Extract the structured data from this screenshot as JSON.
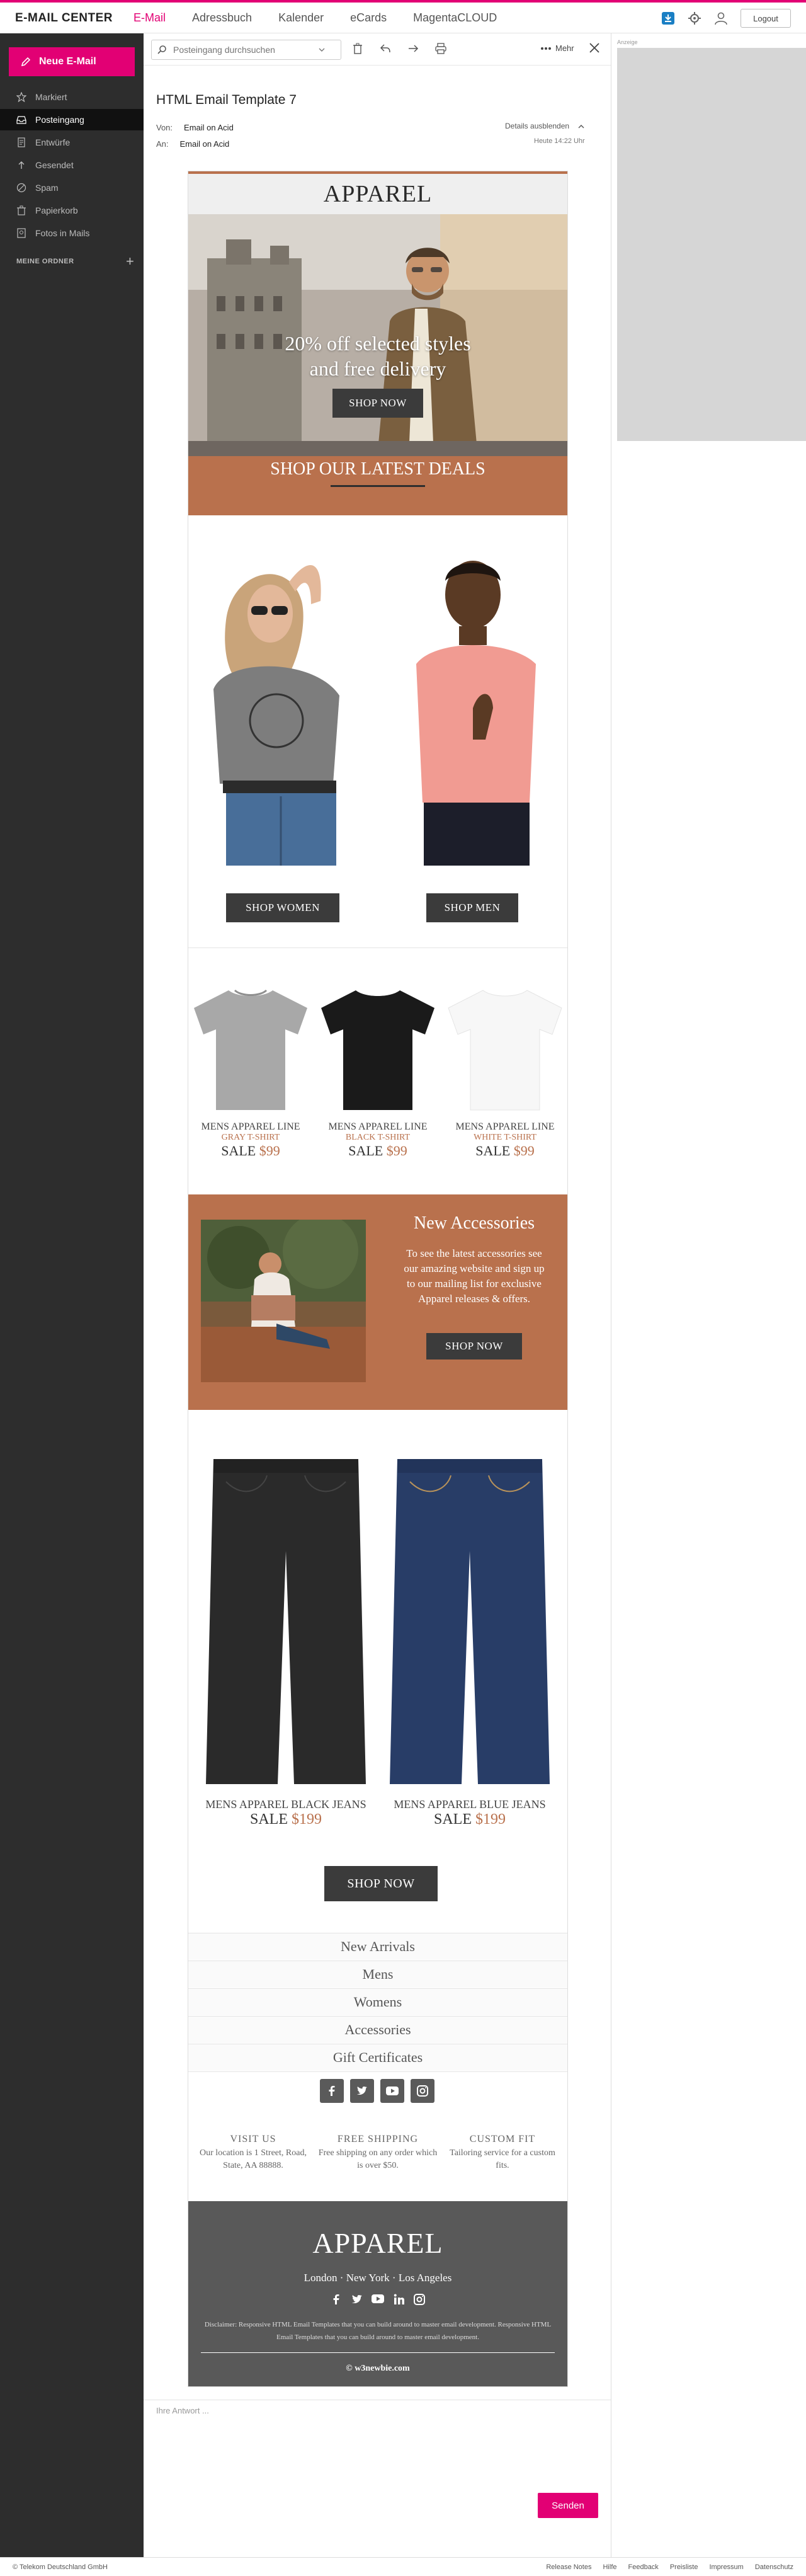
{
  "topbar": {
    "brand": "E-MAIL CENTER",
    "nav": [
      "E-Mail",
      "Adressbuch",
      "Kalender",
      "eCards",
      "MagentaCLOUD"
    ],
    "logout": "Logout"
  },
  "sidebar": {
    "new_mail": "Neue E-Mail",
    "folders": [
      "Markiert",
      "Posteingang",
      "Entwürfe",
      "Gesendet",
      "Spam",
      "Papierkorb",
      "Fotos in Mails"
    ],
    "my_folders": "MEINE ORDNER"
  },
  "toolbar": {
    "search_placeholder": "Posteingang durchsuchen",
    "more": "Mehr"
  },
  "message": {
    "subject": "HTML Email Template 7",
    "from_label": "Von:",
    "from": "Email on Acid",
    "to_label": "An:",
    "to": "Email on Acid",
    "details": "Details ausblenden",
    "date": "Heute 14:22 Uhr"
  },
  "ad": {
    "label": "Anzeige"
  },
  "email": {
    "logo": "APPAREL",
    "hero_line1": "20% off selected styles",
    "hero_line2": "and free delivery",
    "hero_button": "SHOP NOW",
    "deals_title": "SHOP OUR LATEST DEALS",
    "shop_women": "SHOP WOMEN",
    "shop_men": "SHOP MEN",
    "tees": [
      {
        "line": "MENS APPAREL LINE",
        "color": "GRAY T-SHIRT",
        "sale": "SALE",
        "price": "$99"
      },
      {
        "line": "MENS APPAREL LINE",
        "color": "BLACK T-SHIRT",
        "sale": "SALE",
        "price": "$99"
      },
      {
        "line": "MENS APPAREL LINE",
        "color": "WHITE T-SHIRT",
        "sale": "SALE",
        "price": "$99"
      }
    ],
    "accessories": {
      "title": "New Accessories",
      "text": "To see the latest accessories see our amazing website and sign up to our mailing list for exclusive Apparel releases & offers.",
      "button": "SHOP NOW"
    },
    "jeans": [
      {
        "name": "MENS APPAREL BLACK JEANS",
        "sale": "SALE",
        "price": "$199"
      },
      {
        "name": "MENS APPAREL BLUE JEANS",
        "sale": "SALE",
        "price": "$199"
      }
    ],
    "jeans_button": "SHOP NOW",
    "menu": [
      "New Arrivals",
      "Mens",
      "Womens",
      "Accessories",
      "Gift Certificates"
    ],
    "info": [
      {
        "title": "VISIT US",
        "text": "Our location is 1 Street, Road, State, AA 88888."
      },
      {
        "title": "FREE SHIPPING",
        "text": "Free shipping on any order which is over $50."
      },
      {
        "title": "CUSTOM FIT",
        "text": "Tailoring service for a custom fits."
      }
    ],
    "footer": {
      "logo": "APPAREL",
      "cities": "London · New York · Los Angeles",
      "disclaimer": "Disclaimer: Responsive HTML Email Templates that you can build around to master email development. Responsive HTML Email Templates that you can build around to master email development.",
      "copyright": "© w3newbie.com"
    }
  },
  "reply": {
    "placeholder": "Ihre Antwort ...",
    "send": "Senden"
  },
  "footer": {
    "copyright": "© Telekom Deutschland GmbH",
    "links": [
      "Release Notes",
      "Hilfe",
      "Feedback",
      "Preisliste",
      "Impressum",
      "Datenschutz"
    ]
  }
}
